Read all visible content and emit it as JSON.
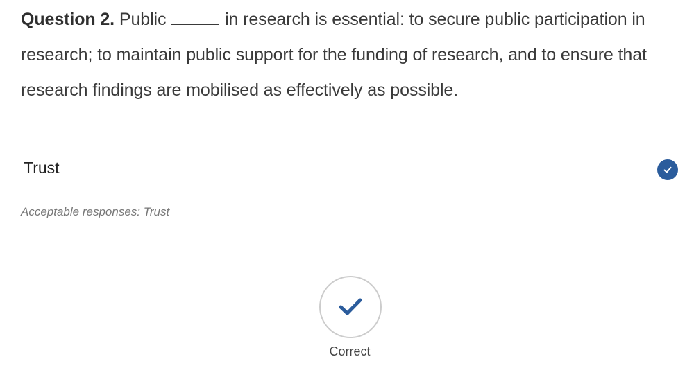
{
  "question": {
    "number_label": "Question 2.",
    "text_before_blank": " Public ",
    "text_after_blank": " in research is essential: to secure public participation in research; to maintain public support for the funding of research, and to ensure that research findings are mobilised as effectively as possible."
  },
  "answer": {
    "value": "Trust",
    "status_icon": "check-circle-icon",
    "status_color": "#2b5c9c"
  },
  "acceptable_responses": "Acceptable responses: Trust",
  "result": {
    "icon": "checkmark-icon",
    "label": "Correct",
    "icon_color": "#2b5c9c"
  }
}
